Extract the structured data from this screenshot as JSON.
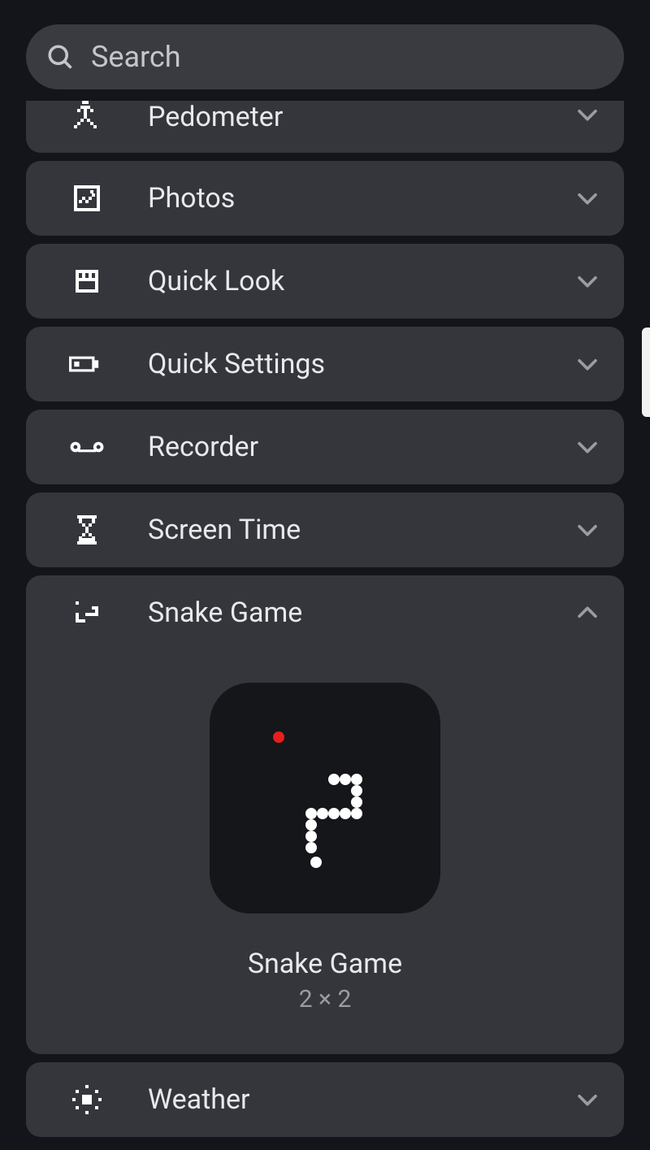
{
  "search": {
    "placeholder": "Search"
  },
  "items": [
    {
      "label": "Pedometer",
      "icon": "pedometer-icon",
      "expanded": false,
      "cut": true
    },
    {
      "label": "Photos",
      "icon": "photos-icon",
      "expanded": false
    },
    {
      "label": "Quick Look",
      "icon": "quick-look-icon",
      "expanded": false
    },
    {
      "label": "Quick Settings",
      "icon": "quick-settings-icon",
      "expanded": false
    },
    {
      "label": "Recorder",
      "icon": "recorder-icon",
      "expanded": false
    },
    {
      "label": "Screen Time",
      "icon": "screen-time-icon",
      "expanded": false
    },
    {
      "label": "Snake Game",
      "icon": "snake-icon",
      "expanded": true,
      "widget": {
        "title": "Snake Game",
        "size": "2 × 2"
      }
    },
    {
      "label": "Weather",
      "icon": "weather-icon",
      "expanded": false
    }
  ]
}
